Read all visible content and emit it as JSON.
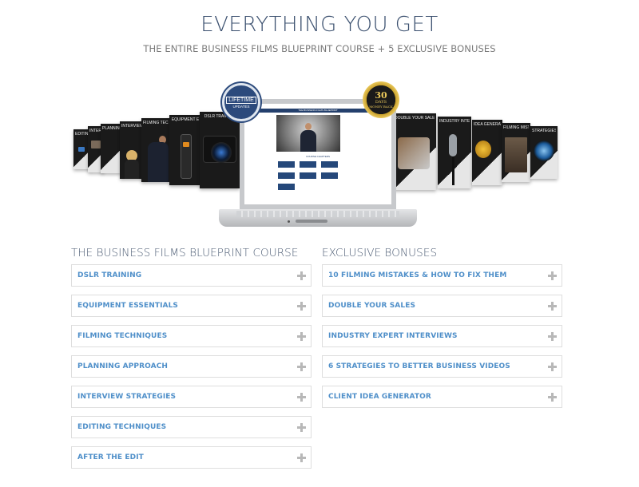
{
  "header": {
    "title": "EVERYTHING YOU GET",
    "subtitle": "THE ENTIRE BUSINESS FILMS BLUEPRINT COURSE + 5 EXCLUSIVE BONUSES"
  },
  "hero": {
    "laptop_screen_title": "THE BUSINESS FILMS BLUEPRINT",
    "laptop_section_label": "COURSE CHAPTERS",
    "badges": {
      "lifetime": {
        "line1": "LIFETIME",
        "line2": "UPDATES"
      },
      "money_back": {
        "line1": "30",
        "line2": "DAYS",
        "line3": "MONEY BACK"
      }
    },
    "left_covers": [
      "EDITING",
      "INTERVIEW",
      "PLANNING",
      "INTERVIEW ST",
      "FILMING TECH",
      "EQUIPMENT E",
      "DSLR TRAINING"
    ],
    "right_covers": [
      "DOUBLE YOUR SALES",
      "INDUSTRY INTERVIEWS",
      "IDEA GENERATOR",
      "FILMING MISTAKES",
      "STRATEGIES"
    ]
  },
  "course": {
    "heading": "THE BUSINESS FILMS BLUEPRINT COURSE",
    "items": [
      {
        "label": "DSLR TRAINING"
      },
      {
        "label": "EQUIPMENT ESSENTIALS"
      },
      {
        "label": "FILMING TECHNIQUES"
      },
      {
        "label": "PLANNING APPROACH"
      },
      {
        "label": "INTERVIEW STRATEGIES"
      },
      {
        "label": "EDITING TECHNIQUES"
      },
      {
        "label": "AFTER THE EDIT"
      }
    ]
  },
  "bonuses": {
    "heading": "EXCLUSIVE BONUSES",
    "items": [
      {
        "label": "10 FILMING MISTAKES & HOW TO FIX THEM"
      },
      {
        "label": "DOUBLE YOUR SALES"
      },
      {
        "label": "INDUSTRY EXPERT INTERVIEWS"
      },
      {
        "label": "6 STRATEGIES TO BETTER BUSINESS VIDEOS"
      },
      {
        "label": "CLIENT IDEA GENERATOR"
      }
    ]
  },
  "colors": {
    "title": "#3a4f6e",
    "item_label": "#4f8fc9",
    "border": "#dedede",
    "plus_icon": "#b8b8b8"
  }
}
